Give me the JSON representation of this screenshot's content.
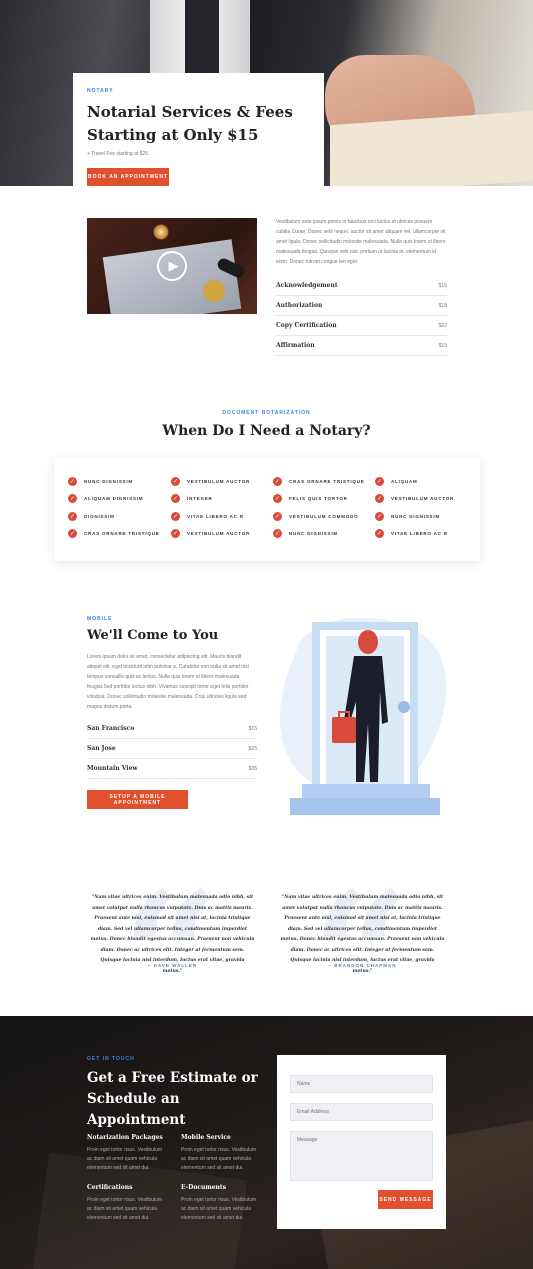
{
  "hero": {
    "eyebrow": "NOTARY",
    "title": "Notarial Services & Fees Starting at Only $15",
    "subtitle": "+ Travel Fee starting at $25",
    "button": "BOOK AN APPOINTMENT"
  },
  "intro": {
    "text": "Vestibulum ante ipsum primis in faucibus orci luctus et ultrices posuere cubilia Curae; Donec velit neque, auctor sit amet aliquam vel, ullamcorper sit amet ligula. Donec sollicitudin molestie malesuada. Nulla quis lorem ut libero malesuada feugiat. Quisque velit nisi, pretium ut lacinia in, elementum id enim. Donec rutrum congue leo eget",
    "prices": [
      {
        "name": "Acknowledgement",
        "price": "$15"
      },
      {
        "name": "Authorization",
        "price": "$18"
      },
      {
        "name": "Copy Certification",
        "price": "$22"
      },
      {
        "name": "Affirmation",
        "price": "$15"
      }
    ]
  },
  "need": {
    "eyebrow": "DOCUMENT NOTARIZATION",
    "title": "When Do I Need a Notary?",
    "items": [
      "NUNC DIGNISSIM",
      "VESTIBULUM AUCTOR",
      "CRAS ORNARE TRISTIQUE",
      "ALIQUAM",
      "ALIQUAM DIGNISSIM",
      "INTEGER",
      "FELIS QUIS TORTOR",
      "VESTIBULUM AUCTOR",
      "DIGNISSIM",
      "VITAE LIBERO AC R",
      "VESTIBULUM COMMODO",
      "NUNC DIGNISSIM",
      "CRAS ORNARE TRISTIQUE",
      "VESTIBULUM AUCTOR",
      "NUNC DIGNISSIM",
      "VITAE LIBERO AC R"
    ]
  },
  "mobile": {
    "eyebrow": "MOBILE",
    "title": "We'll Come to You",
    "text": "Lorem ipsum dolor sit amet, consectetur adipiscing elit. Mauris blandit aliquet elit, eget tincidunt nibh pulvinar a. Curabitur non nulla sit amet nisl tempus convallis quis ac lectus. Nulla quis lorem ut libero malesuada feugiat.Sed porttitor lectus nibh. Vivamus suscipit tortor eget felis porttitor volutpat. Donec sollicitudin molestie malesuada. Cras ultricies ligula sed magna dictum porta.",
    "prices": [
      {
        "name": "San Francisco",
        "price": "$15"
      },
      {
        "name": "San Jose",
        "price": "$25"
      },
      {
        "name": "Mountain View",
        "price": "$35"
      }
    ],
    "button": "SETUP A MOBILE APPOINTMENT"
  },
  "quotes": [
    {
      "text": "\"Nam vitae ultrices enim. Vestibulum malesuada odio nibh, sit amet volutpat nulla rhoncus vulputate. Duis ac mattis mauris. Praesent ante nisl, euismod sit amet nisi at, lacinia tristique diam. Sed vel ullamcorper tellus, condimentum imperdiet metus. Donec blandit egestas accumsan. Praesent non vehicula diam. Donec ac ultrices elit. Integer at fermentum sem. Quisque lacinia nisl interdum, luctus erat vitae, gravida metus.\"",
      "author": "– DAVE WALLER"
    },
    {
      "text": "\"Nam vitae ultrices enim. Vestibulum malesuada odio nibh, sit amet volutpat nulla rhoncus vulputate. Duis ac mattis mauris. Praesent ante nisl, euismod sit amet nisi at, lacinia tristique diam. Sed vel ullamcorper tellus, condimentum imperdiet metus. Donec blandit egestas accumsan. Praesent non vehicula diam. Donec ac ultrices elit. Integer at fermentum sem. Quisque lacinia nisl interdum, luctus erat vitae, gravida metus.\"",
      "author": "– BRANDON CHAPMAN"
    }
  ],
  "contact": {
    "eyebrow": "GET IN TOUCH",
    "title": "Get a Free Estimate or Schedule an Appointment",
    "services": [
      {
        "title": "Notarization Packages",
        "desc": "Proin eget tortor risus. Vestibulum ac diam sit amet quam vehicula elementum sed sit amet dui."
      },
      {
        "title": "Mobile Service",
        "desc": "Proin eget tortor risus. Vestibulum ac diam sit amet quam vehicula elementum sed sit amet dui."
      },
      {
        "title": "Certifications",
        "desc": "Proin eget tortor risus. Vestibulum ac diam sit amet quam vehicula elementum sed sit amet dui."
      },
      {
        "title": "E-Documents",
        "desc": "Proin eget tortor risus. Vestibulum ac diam sit amet quam vehicula elementum sed sit amet dui."
      }
    ],
    "form": {
      "name_placeholder": "Name",
      "email_placeholder": "Email Address",
      "message_placeholder": "Message",
      "send": "SEND MESSAGE"
    }
  },
  "colors": {
    "accent": "#e0502f",
    "blue": "#3b86d6",
    "check": "#d84b3b"
  }
}
